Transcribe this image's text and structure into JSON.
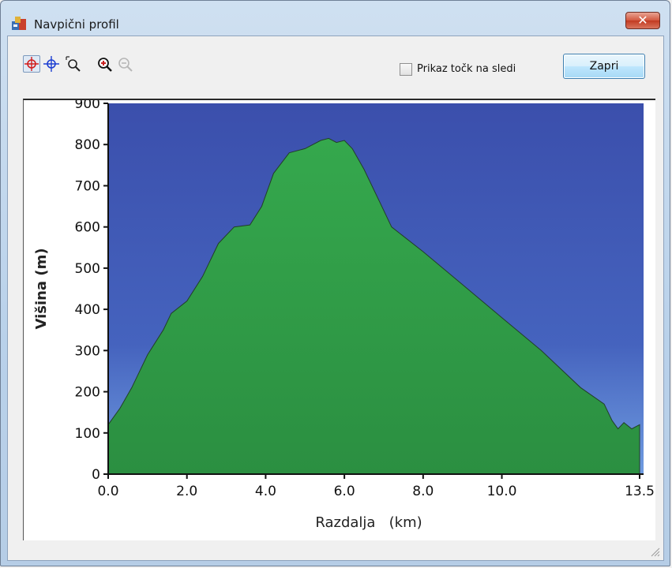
{
  "window": {
    "title": "Navpični profil",
    "close_glyph": "✕"
  },
  "toolbar": {
    "tools": [
      {
        "name": "crosshair-red-icon",
        "active": true
      },
      {
        "name": "crosshair-blue-icon",
        "active": false
      },
      {
        "name": "zoom-area-icon",
        "active": false
      },
      {
        "name": "zoom-in-icon",
        "active": false
      },
      {
        "name": "zoom-out-icon",
        "active": false,
        "disabled": true
      }
    ],
    "show_points_label": "Prikaz točk na sledi",
    "show_points_checked": false,
    "close_label": "Zapri"
  },
  "colors": {
    "sky": "#3f56b0",
    "terrain": "#2f9a45",
    "terrain_edge": "#1f3a26",
    "titlebar": "#c4d8ee",
    "close_button": "#c94a31"
  },
  "chart_data": {
    "type": "area",
    "xlabel": "Razdalja   (km)",
    "ylabel": "Višina (m)",
    "xlim": [
      0,
      13.6
    ],
    "ylim": [
      0,
      900
    ],
    "xticks": [
      "0.0",
      "2.0",
      "4.0",
      "6.0",
      "8.0",
      "10.0",
      "13.5"
    ],
    "xtick_values": [
      0,
      2,
      4,
      6,
      8,
      10,
      13.5
    ],
    "yticks": [
      "0",
      "100",
      "200",
      "300",
      "400",
      "500",
      "600",
      "700",
      "800",
      "900"
    ],
    "ytick_values": [
      0,
      100,
      200,
      300,
      400,
      500,
      600,
      700,
      800,
      900
    ],
    "grid": false,
    "series": [
      {
        "name": "",
        "x": [
          0,
          0.3,
          0.6,
          1.0,
          1.4,
          1.6,
          2.0,
          2.4,
          2.8,
          3.2,
          3.6,
          3.9,
          4.2,
          4.6,
          5.0,
          5.4,
          5.6,
          5.8,
          6.0,
          6.2,
          6.5,
          6.9,
          7.2,
          8.0,
          9.0,
          10.0,
          11.0,
          12.0,
          12.6,
          12.8,
          12.95,
          13.1,
          13.3,
          13.5
        ],
        "y": [
          120,
          160,
          210,
          290,
          350,
          390,
          420,
          480,
          560,
          600,
          605,
          650,
          730,
          780,
          790,
          810,
          815,
          805,
          810,
          790,
          740,
          660,
          600,
          540,
          460,
          380,
          300,
          210,
          170,
          130,
          110,
          125,
          110,
          120
        ]
      }
    ]
  }
}
